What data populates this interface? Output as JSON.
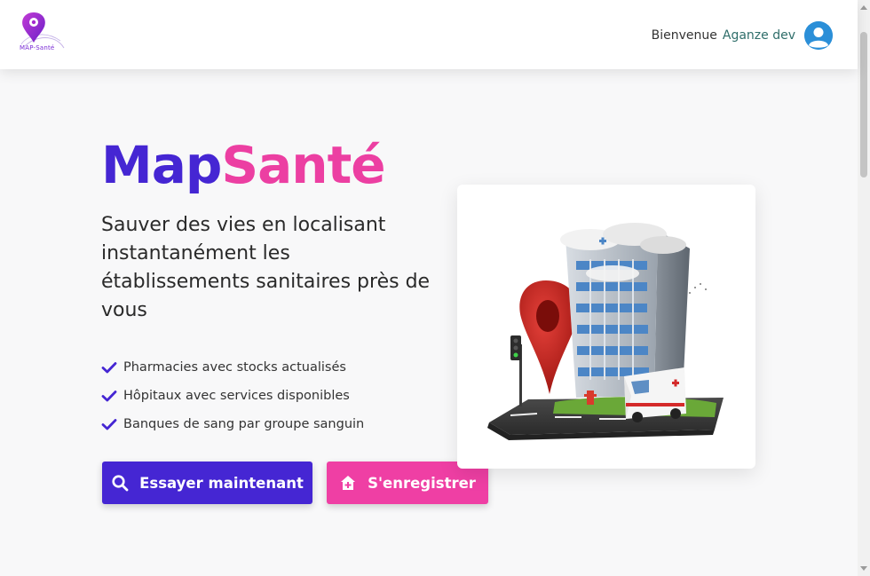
{
  "header": {
    "logo_text": "MAP-Santé",
    "welcome_label": "Bienvenue",
    "user_name": "Aganze dev"
  },
  "hero": {
    "title_part1": "Map",
    "title_part2": "Santé",
    "tagline": "Sauver des vies en localisant instantanément les établissements sanitaires près de vous",
    "features": [
      "Pharmacies avec stocks actualisés",
      "Hôpitaux avec services disponibles",
      "Banques de sang par groupe sanguin"
    ],
    "buttons": {
      "try_label": "Essayer maintenant",
      "register_label": "S'enregistrer"
    }
  },
  "icons": {
    "logo": "map-pin-icon",
    "avatar": "user-avatar-icon",
    "check": "check-icon",
    "search": "search-icon",
    "register": "hospital-icon"
  },
  "colors": {
    "primary": "#4526d3",
    "accent": "#ec3fa2",
    "user_name": "#2f6e6a",
    "avatar": "#2b8fd8"
  }
}
